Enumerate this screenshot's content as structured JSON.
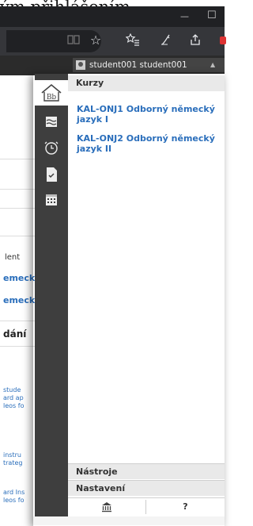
{
  "top_snippet": "ým přihlášením.",
  "chrome": {
    "minimize_glyph": "—",
    "maximize_glyph": "☐"
  },
  "toolbar_icons": [
    "reader-mode-icon",
    "star-icon",
    "favorites-icon",
    "pen-icon",
    "share-icon",
    "extension-icon"
  ],
  "user": {
    "name": "student001 student001"
  },
  "left_page": {
    "text_ent": "lent",
    "link1": "emeck",
    "link2": "emeck",
    "heading": "dání",
    "snippet1": [
      "stude",
      "ard ap",
      "leos fo"
    ],
    "snippet2": [
      "instru",
      "trateg"
    ],
    "snippet3": [
      "ard Ins",
      "leos fo"
    ]
  },
  "menu": {
    "section_courses": "Kurzy",
    "courses": [
      "KAL-ONJ1 Odborný německý jazyk I",
      "KAL-ONJ2 Odborný německý jazyk II"
    ],
    "section_tools": "Nástroje",
    "section_settings": "Nastavení",
    "help_label": "?"
  },
  "sidebar_icons": [
    "bb-home-icon",
    "courses-icon",
    "clock-icon",
    "document-check-icon",
    "calendar-icon"
  ],
  "colors": {
    "link": "#2a6ebb",
    "iconbar": "#3e3e3e",
    "header": "#2b2b2b"
  }
}
